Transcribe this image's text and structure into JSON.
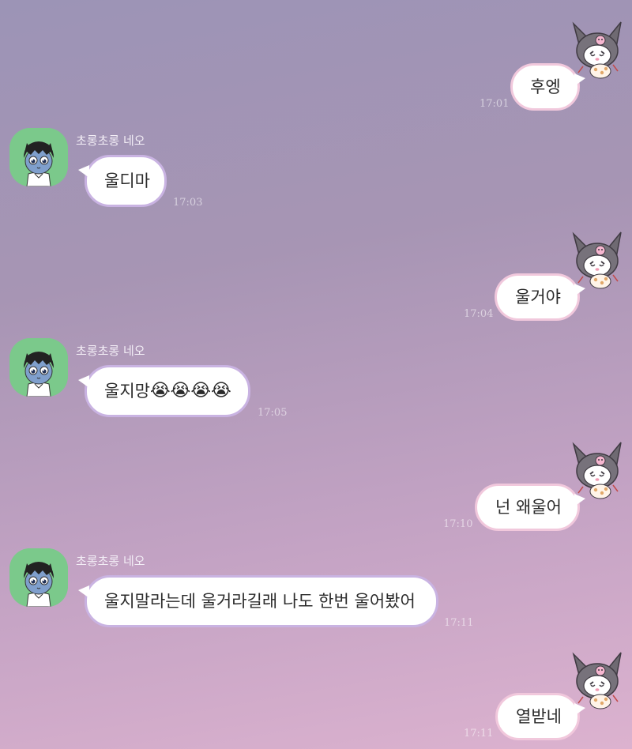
{
  "contact": {
    "name": "초롱초롱 네오"
  },
  "messages": [
    {
      "side": "mine",
      "text": "후엥",
      "time": "17:01"
    },
    {
      "side": "theirs",
      "sender": "초롱초롱 네오",
      "text": "울디마",
      "time": "17:03"
    },
    {
      "side": "mine",
      "text": "울거야",
      "time": "17:04"
    },
    {
      "side": "theirs",
      "sender": "초롱초롱 네오",
      "text": "울지망",
      "emoji": "😭😭😭😭",
      "time": "17:05"
    },
    {
      "side": "mine",
      "text": "넌 왜울어",
      "time": "17:10"
    },
    {
      "side": "theirs",
      "sender": "초롱초롱 네오",
      "text": "울지말라는데 울거라길래 나도 한번 울어봤어",
      "time": "17:11"
    },
    {
      "side": "mine",
      "text": "열받네",
      "time": "17:11"
    }
  ],
  "icons": {
    "my_avatar": "kuromi-avatar-icon",
    "their_avatar": "neo-avatar-icon"
  },
  "colors": {
    "background_top": "#9c94b6",
    "background_bottom": "#dcb2cf",
    "bubble": "#ffffff",
    "my_bubble_border": "#f1c8dc",
    "their_bubble_border": "#c9b3e2",
    "avatar_bg": "#7bc98b"
  }
}
